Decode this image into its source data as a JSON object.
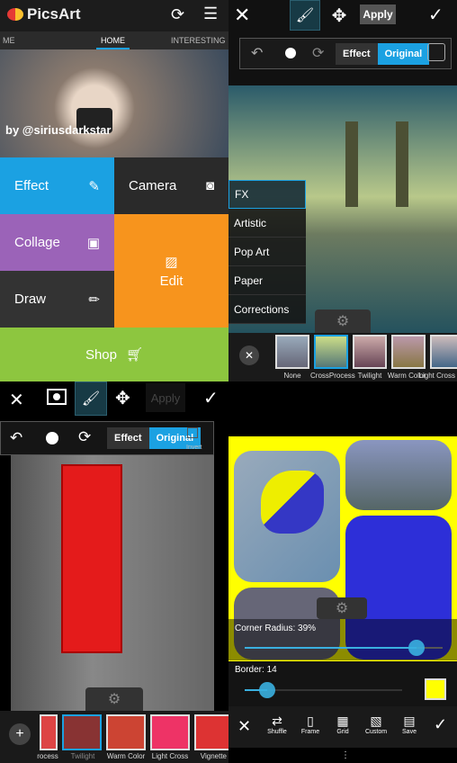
{
  "home": {
    "app_name": "PicsArt",
    "tabs": [
      "ME",
      "HOME",
      "INTERESTING"
    ],
    "photo_credit": "by @siriusdarkstar",
    "tiles": {
      "effect": "Effect",
      "camera": "Camera",
      "collage": "Collage",
      "edit": "Edit",
      "draw": "Draw",
      "shop": "Shop"
    },
    "colors": {
      "effect": "#1ba1e2",
      "collage": "#9b63b8",
      "edit": "#f7941d",
      "shop": "#8dc63f"
    }
  },
  "effect_editor": {
    "apply": "Apply",
    "effect": "Effect",
    "original": "Original",
    "menu": [
      "FX",
      "Artistic",
      "Pop Art",
      "Paper",
      "Corrections"
    ],
    "filters": [
      "None",
      "CrossProcess",
      "Twilight",
      "Warm Color",
      "Light Cross"
    ],
    "selected_filter": "CrossProcess"
  },
  "brush_editor": {
    "apply": "Apply",
    "effect": "Effect",
    "original": "Original",
    "invert": "Invert",
    "filters": [
      "rocess",
      "Twilight",
      "Warm Color",
      "Light Cross",
      "Vignette"
    ],
    "selected_filter": "Twilight"
  },
  "collage_editor": {
    "corner_radius_label": "Corner Radius: 39%",
    "corner_radius": 39,
    "border_label": "Border: 14",
    "border": 14,
    "border_color": "#ffff00",
    "toolbar": [
      "Shuffle",
      "Frame",
      "Grid",
      "Custom",
      "Save"
    ]
  }
}
